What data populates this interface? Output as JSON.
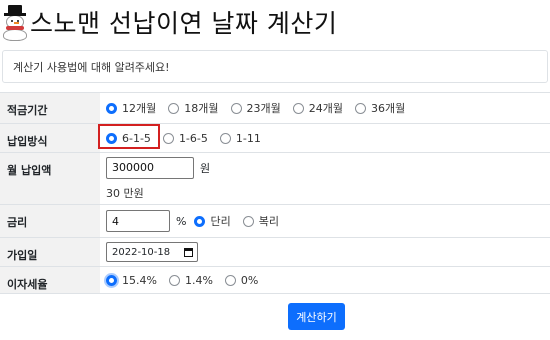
{
  "header": {
    "title": "스노맨 선납이연 날짜 계산기"
  },
  "help": {
    "text": "계산기 사용법에 대해 알려주세요!"
  },
  "fields": {
    "period": {
      "label": "적금기간",
      "options": [
        "12개월",
        "18개월",
        "23개월",
        "24개월",
        "36개월"
      ],
      "selected": "12개월"
    },
    "method": {
      "label": "납입방식",
      "options": [
        "6-1-5",
        "1-6-5",
        "1-11"
      ],
      "selected": "6-1-5"
    },
    "monthly": {
      "label": "월 납입액",
      "value": "300000",
      "unit": "원",
      "hint": "30 만원"
    },
    "rate": {
      "label": "금리",
      "value": "4",
      "unit": "%",
      "options": [
        "단리",
        "복리"
      ],
      "selected": "단리"
    },
    "join_date": {
      "label": "가입일",
      "value": "2022-10-18"
    },
    "tax": {
      "label": "이자세율",
      "options": [
        "15.4%",
        "1.4%",
        "0%"
      ],
      "selected": "15.4%"
    }
  },
  "actions": {
    "calculate_label": "계산하기"
  },
  "colors": {
    "accent": "#0d6efd",
    "highlight": "#d32020"
  }
}
